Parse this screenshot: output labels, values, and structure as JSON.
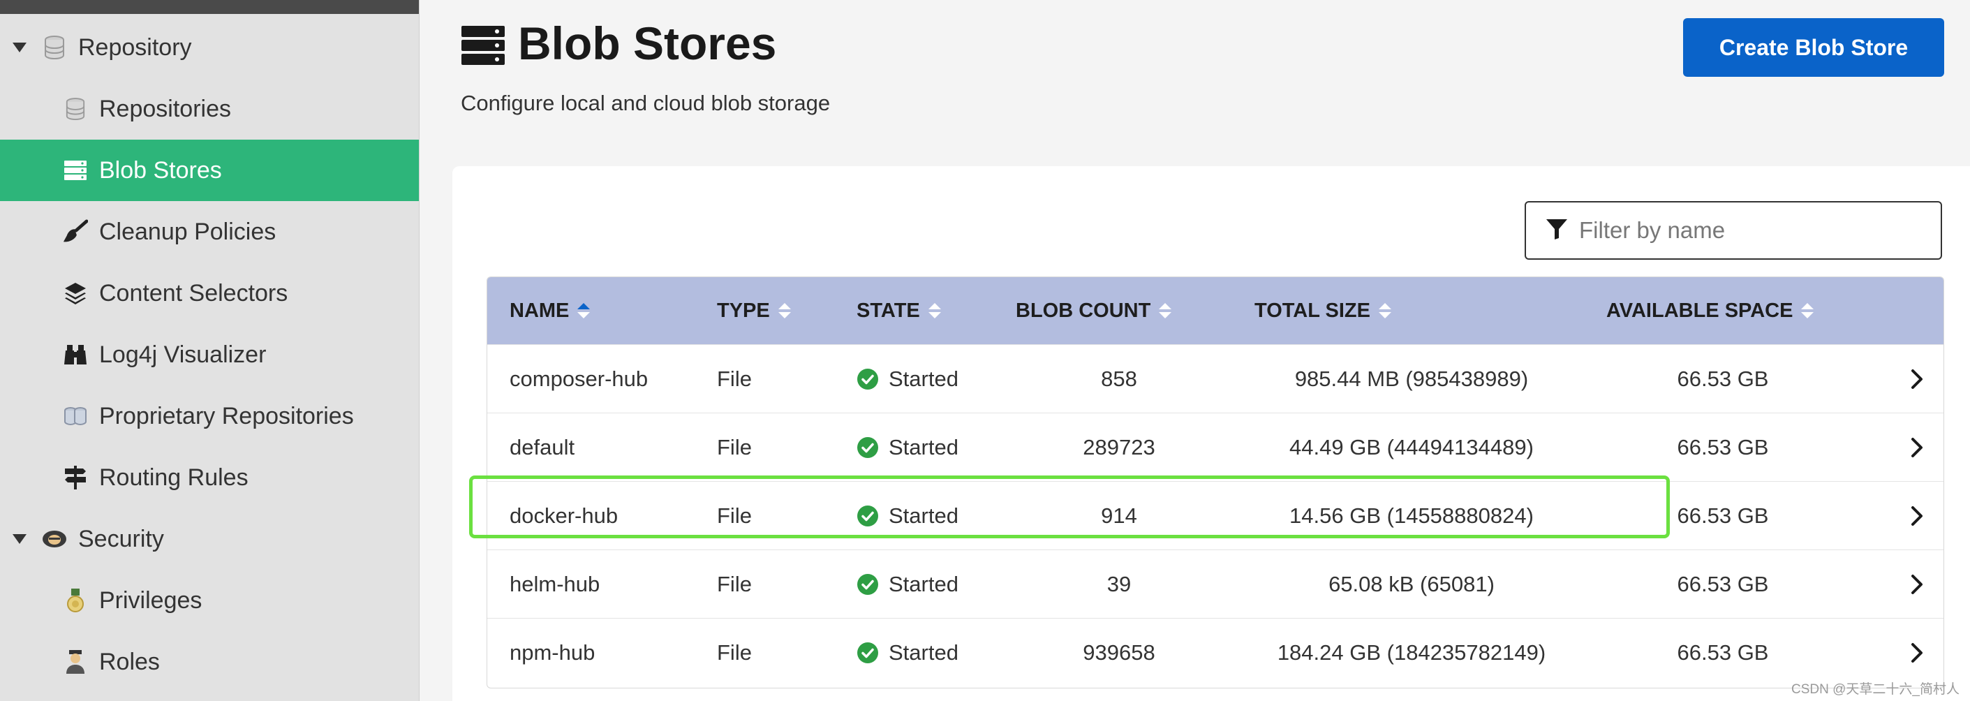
{
  "sidebar": {
    "items": [
      {
        "label": "Repository",
        "icon": "database-icon",
        "level": "parent",
        "expanded": true,
        "active": false
      },
      {
        "label": "Repositories",
        "icon": "database-icon",
        "level": "child",
        "active": false
      },
      {
        "label": "Blob Stores",
        "icon": "server-icon",
        "level": "child",
        "active": true
      },
      {
        "label": "Cleanup Policies",
        "icon": "broom-icon",
        "level": "child",
        "active": false
      },
      {
        "label": "Content Selectors",
        "icon": "layers-icon",
        "level": "child",
        "active": false
      },
      {
        "label": "Log4j Visualizer",
        "icon": "binoculars-icon",
        "level": "child",
        "active": false
      },
      {
        "label": "Proprietary Repositories",
        "icon": "database-icon",
        "level": "child",
        "active": false
      },
      {
        "label": "Routing Rules",
        "icon": "signpost-icon",
        "level": "child",
        "active": false
      },
      {
        "label": "Security",
        "icon": "security-icon",
        "level": "parent",
        "expanded": true,
        "active": false
      },
      {
        "label": "Privileges",
        "icon": "medal-icon",
        "level": "child",
        "active": false
      },
      {
        "label": "Roles",
        "icon": "user-role-icon",
        "level": "child",
        "active": false
      }
    ]
  },
  "header": {
    "title": "Blob Stores",
    "subtitle": "Configure local and cloud blob storage",
    "create_button": "Create Blob Store"
  },
  "filter": {
    "placeholder": "Filter by name",
    "value": ""
  },
  "table": {
    "columns": [
      "NAME",
      "TYPE",
      "STATE",
      "BLOB COUNT",
      "TOTAL SIZE",
      "AVAILABLE SPACE"
    ],
    "sorted_column": "NAME",
    "sort_direction": "ascending",
    "rows": [
      {
        "name": "composer-hub",
        "type": "File",
        "state": "Started",
        "blob_count": "858",
        "total_size": "985.44 MB (985438989)",
        "available_space": "66.53 GB"
      },
      {
        "name": "default",
        "type": "File",
        "state": "Started",
        "blob_count": "289723",
        "total_size": "44.49 GB (44494134489)",
        "available_space": "66.53 GB"
      },
      {
        "name": "docker-hub",
        "type": "File",
        "state": "Started",
        "blob_count": "914",
        "total_size": "14.56 GB (14558880824)",
        "available_space": "66.53 GB",
        "highlighted": true
      },
      {
        "name": "helm-hub",
        "type": "File",
        "state": "Started",
        "blob_count": "39",
        "total_size": "65.08 kB (65081)",
        "available_space": "66.53 GB"
      },
      {
        "name": "npm-hub",
        "type": "File",
        "state": "Started",
        "blob_count": "939658",
        "total_size": "184.24 GB (184235782149)",
        "available_space": "66.53 GB"
      }
    ]
  },
  "colors": {
    "active_nav": "#2db57a",
    "primary_button": "#0a63c9",
    "table_header": "#b3bddf",
    "status_ok": "#2e9e44",
    "highlight_border": "#6be040"
  },
  "watermark": "CSDN @天草二十六_简村人"
}
